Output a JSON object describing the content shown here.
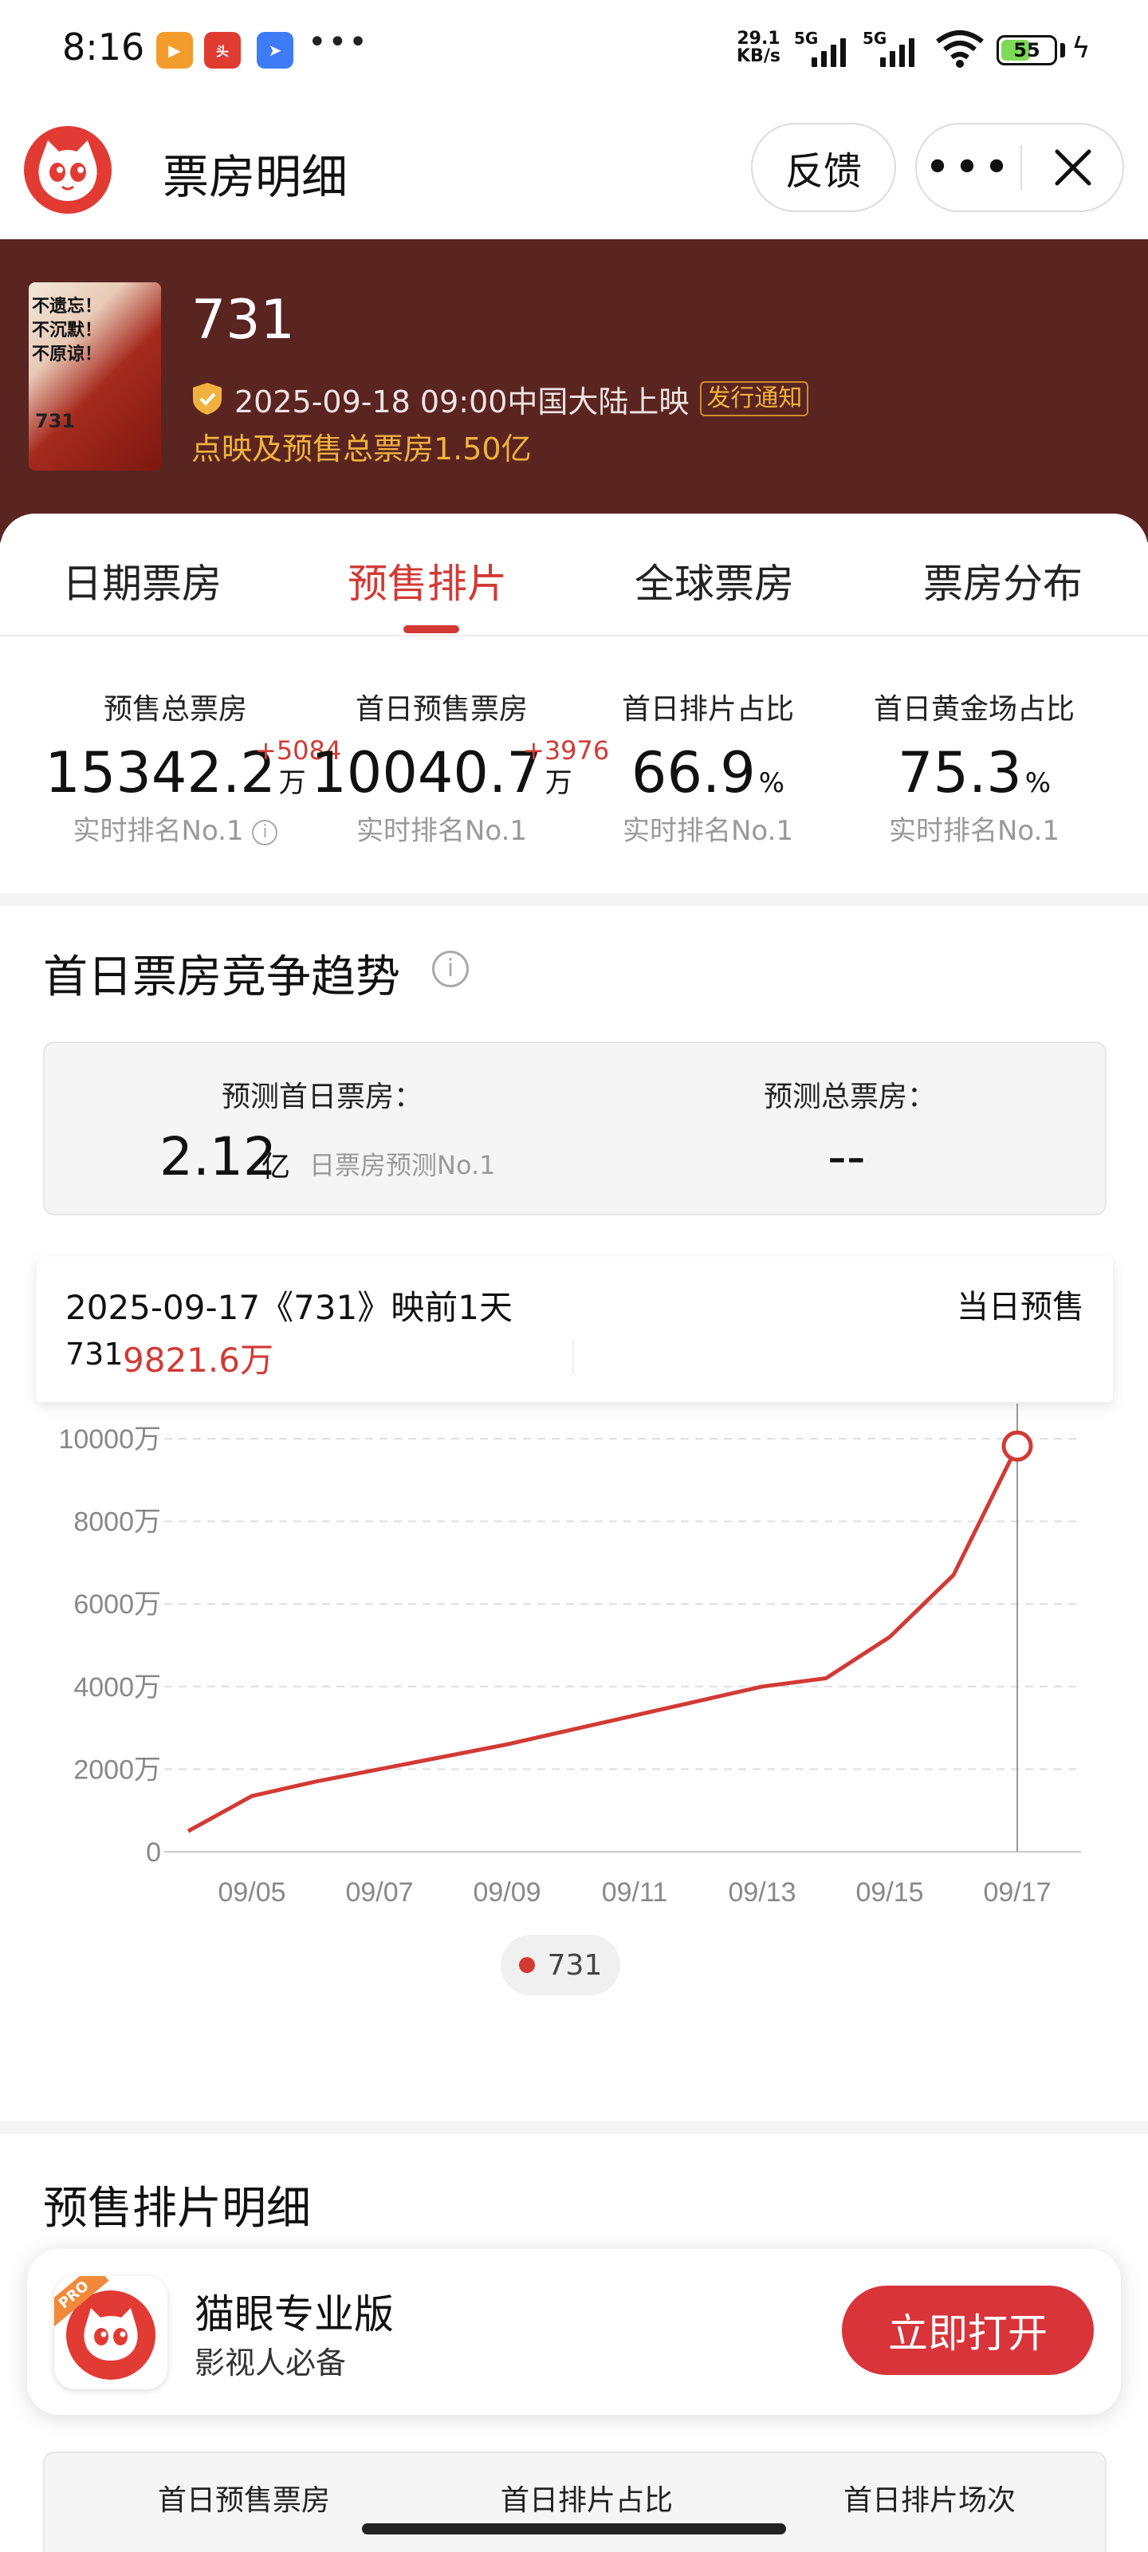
{
  "status_bar": {
    "time": "8:16",
    "speed_value": "29.1",
    "speed_unit": "KB/s",
    "network_1": "5G",
    "network_2": "5G",
    "battery": "55"
  },
  "nav": {
    "title": "票房明细",
    "feedback_label": "反馈",
    "more_label": "•••"
  },
  "movie": {
    "name": "731",
    "release_info": "2025-09-18 09:00中国大陆上映",
    "notice_tag": "发行通知",
    "presale_total": "点映及预售总票房1.50亿",
    "poster_text": "不遗忘！不沉默！不原谅！",
    "poster_title": "731"
  },
  "tabs": [
    {
      "label": "日期票房"
    },
    {
      "label": "预售排片"
    },
    {
      "label": "全球票房"
    },
    {
      "label": "票房分布"
    }
  ],
  "active_tab": "预售排片",
  "stats": [
    {
      "label": "预售总票房",
      "value": "15342.2",
      "unit": "万",
      "delta": "+5084",
      "rank": "实时排名No.1"
    },
    {
      "label": "首日预售票房",
      "value": "10040.7",
      "unit": "万",
      "delta": "+3976",
      "rank": "实时排名No.1"
    },
    {
      "label": "首日排片占比",
      "value": "66.9",
      "unit": "%",
      "delta": "",
      "rank": "实时排名No.1"
    },
    {
      "label": "首日黄金场占比",
      "value": "75.3",
      "unit": "%",
      "delta": "",
      "rank": "实时排名No.1"
    }
  ],
  "trend": {
    "title": "首日票房竞争趋势",
    "forecast_first_day_label": "预测首日票房：",
    "forecast_first_day_value": "2.12",
    "forecast_first_day_unit": "亿",
    "forecast_first_day_rank": "日票房预测No.1",
    "forecast_total_label": "预测总票房：",
    "forecast_total_value": "--"
  },
  "tooltip": {
    "date_line": "2025-09-17《731》映前1天",
    "right_label": "当日预售",
    "series": "731",
    "value": "9821.6万"
  },
  "chart_data": {
    "type": "line",
    "x": [
      "09/04",
      "09/05",
      "09/06",
      "09/07",
      "09/08",
      "09/09",
      "09/10",
      "09/11",
      "09/12",
      "09/13",
      "09/14",
      "09/15",
      "09/16",
      "09/17"
    ],
    "x_tick_labels": [
      "09/05",
      "09/07",
      "09/09",
      "09/11",
      "09/13",
      "09/15",
      "09/17"
    ],
    "series": [
      {
        "name": "731",
        "values": [
          500,
          1350,
          1700,
          2000,
          2300,
          2600,
          2950,
          3300,
          3650,
          4000,
          4200,
          5200,
          6700,
          9821.6
        ]
      }
    ],
    "y_ticks": [
      "0",
      "2000万",
      "4000万",
      "6000万",
      "8000万",
      "10000万"
    ],
    "ylim": [
      0,
      10000
    ],
    "highlight_index": 13,
    "color": "#d23a35",
    "grid": true
  },
  "detail": {
    "title": "预售排片明细",
    "headers": [
      "首日预售票房",
      "首日排片占比",
      "首日排片场次"
    ]
  },
  "banner": {
    "app_name": "猫眼专业版",
    "subtitle": "影视人必备",
    "open_label": "立即打开",
    "pro_tag": "PRO"
  }
}
